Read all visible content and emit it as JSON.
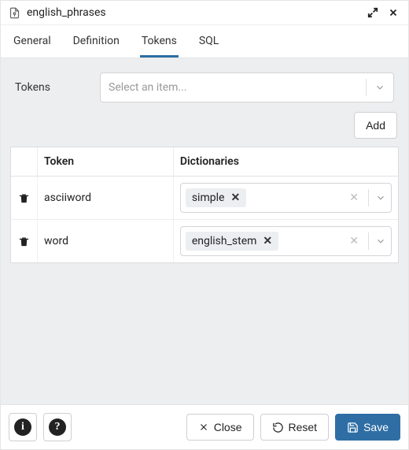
{
  "title": "english_phrases",
  "tabs": [
    {
      "label": "General",
      "active": false
    },
    {
      "label": "Definition",
      "active": false
    },
    {
      "label": "Tokens",
      "active": true
    },
    {
      "label": "SQL",
      "active": false
    }
  ],
  "tokens": {
    "label": "Tokens",
    "placeholder": "Select an item...",
    "add_label": "Add",
    "table": {
      "columns": [
        "Token",
        "Dictionaries"
      ],
      "rows": [
        {
          "token": "asciiword",
          "dictionaries": [
            "simple"
          ]
        },
        {
          "token": "word",
          "dictionaries": [
            "english_stem"
          ]
        }
      ]
    }
  },
  "footer": {
    "close": "Close",
    "reset": "Reset",
    "save": "Save"
  }
}
